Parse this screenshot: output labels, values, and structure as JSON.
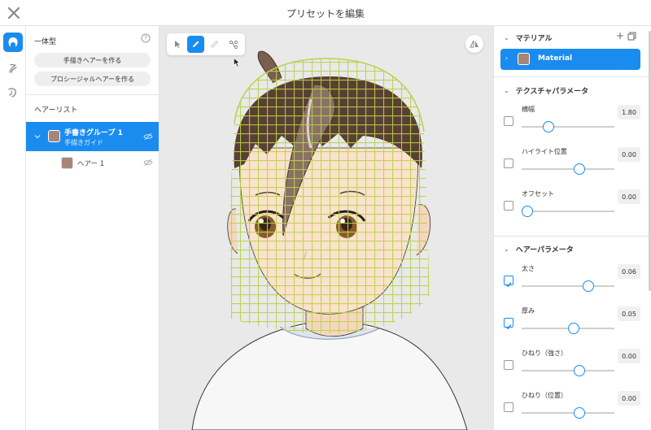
{
  "window": {
    "title": "プリセットを編集"
  },
  "left": {
    "type_label": "一体型",
    "help_icon": "question-circle-icon",
    "buttons": {
      "handdrawn": "手描きヘアーを作る",
      "procedural": "プロシージャルヘアーを作る"
    },
    "hair_list_label": "ヘアーリスト",
    "group": {
      "name": "手書きグループ 1",
      "sub": "手描きガイド",
      "swatch": "#a68677"
    },
    "hair": {
      "name": "ヘアー 1",
      "swatch": "#a68677"
    }
  },
  "right": {
    "material_section": {
      "title": "マテリアル",
      "item": "Material",
      "swatch": "#a68677"
    },
    "texture_section": {
      "title": "テクスチャパラメータ",
      "params": [
        {
          "label": "横幅",
          "value": "1.80",
          "level": 0.29,
          "checked": false
        },
        {
          "label": "ハイライト位置",
          "value": "0.00",
          "level": 0.62,
          "checked": false
        },
        {
          "label": "オフセット",
          "value": "0.00",
          "level": 0.06,
          "checked": false
        }
      ]
    },
    "hair_section": {
      "title": "ヘアーパラメータ",
      "params": [
        {
          "label": "太さ",
          "value": "0.06",
          "level": 0.72,
          "checked": true
        },
        {
          "label": "厚み",
          "value": "0.05",
          "level": 0.56,
          "checked": true
        },
        {
          "label": "ひねり（強さ）",
          "value": "0.00",
          "level": 0.62,
          "checked": false
        },
        {
          "label": "ひねり（位置）",
          "value": "0.00",
          "level": 0.62,
          "checked": false
        }
      ]
    }
  },
  "colors": {
    "accent": "#1a8cf0",
    "grid": "#b7d24a",
    "hair": "#5a3f33"
  }
}
